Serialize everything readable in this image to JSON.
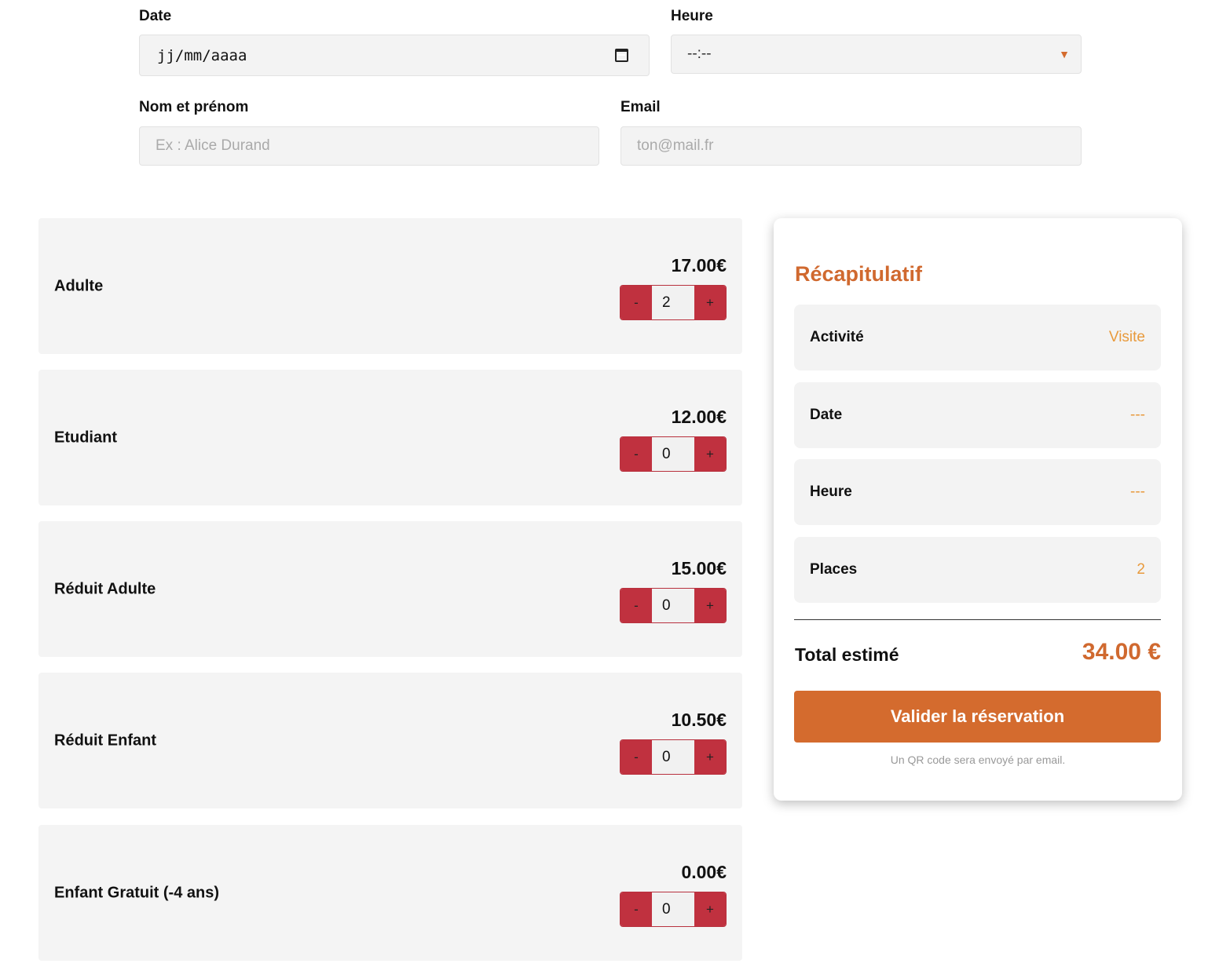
{
  "form": {
    "date_label": "Date",
    "date_value": "jj/mm/aaaa",
    "time_label": "Heure",
    "time_value": "--:--",
    "name_label": "Nom et prénom",
    "name_placeholder": "Ex : Alice Durand",
    "email_label": "Email",
    "email_placeholder": "ton@mail.fr"
  },
  "tickets": [
    {
      "name": "Adulte",
      "price": "17.00€",
      "quantity": "2"
    },
    {
      "name": "Etudiant",
      "price": "12.00€",
      "quantity": "0"
    },
    {
      "name": "Réduit Adulte",
      "price": "15.00€",
      "quantity": "0"
    },
    {
      "name": "Réduit Enfant",
      "price": "10.50€",
      "quantity": "0"
    },
    {
      "name": "Enfant Gratuit (-4 ans)",
      "price": "0.00€",
      "quantity": "0"
    }
  ],
  "stepper": {
    "minus": "-",
    "plus": "+"
  },
  "summary": {
    "title": "Récapitulatif",
    "rows": [
      {
        "key": "Activité",
        "value": "Visite"
      },
      {
        "key": "Date",
        "value": "---"
      },
      {
        "key": "Heure",
        "value": "---"
      },
      {
        "key": "Places",
        "value": "2"
      }
    ],
    "total_label": "Total estimé",
    "total_value": "34.00 €",
    "submit_label": "Valider la réservation",
    "note": "Un QR code sera envoyé par email."
  },
  "colors": {
    "accent": "#d46b2e",
    "stepper": "#c0313f",
    "summary_value": "#e89a3c"
  }
}
